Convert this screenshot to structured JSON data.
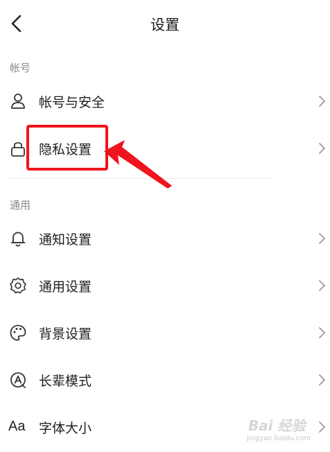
{
  "header": {
    "title": "设置",
    "back_icon": "chevron-left-icon"
  },
  "sections": [
    {
      "title": "帐号",
      "items": [
        {
          "label": "帐号与安全",
          "icon": "user-icon"
        },
        {
          "label": "隐私设置",
          "icon": "lock-icon",
          "highlighted": true
        }
      ]
    },
    {
      "title": "通用",
      "items": [
        {
          "label": "通知设置",
          "icon": "bell-icon"
        },
        {
          "label": "通用设置",
          "icon": "gear-icon"
        },
        {
          "label": "背景设置",
          "icon": "palette-icon"
        },
        {
          "label": "长辈模式",
          "icon": "elder-mode-icon"
        },
        {
          "label": "字体大小",
          "icon": "font-size-icon",
          "icon_text": "Aa"
        }
      ]
    }
  ],
  "annotation": {
    "color": "#f0141e"
  },
  "watermark": {
    "brand": "Bai 经验",
    "url": "jingyan.baidu.com"
  }
}
